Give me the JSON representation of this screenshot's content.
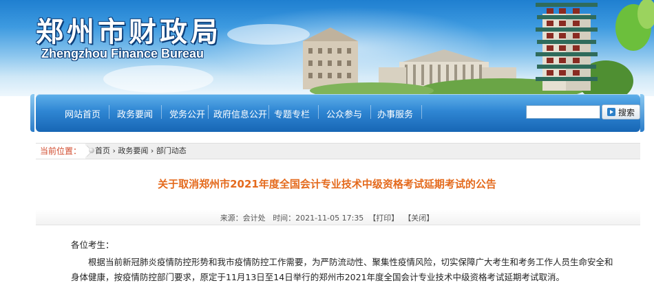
{
  "header": {
    "site_title": "郑州市财政局",
    "site_subtitle": "Zhengzhou Finance Bureau"
  },
  "nav": {
    "items": [
      "网站首页",
      "政务要闻",
      "党务公开",
      "政府信息公开",
      "专题专栏",
      "公众参与",
      "办事服务"
    ],
    "search_value": "",
    "search_button": "搜索"
  },
  "breadcrumb": {
    "label": "当前位置：",
    "items": [
      "首页",
      "政务要闻",
      "部门动态"
    ],
    "separator": " › "
  },
  "article": {
    "title": "关于取消郑州市2021年度全国会计专业技术中级资格考试延期考试的公告",
    "meta": {
      "source": "来源：会计处",
      "time": "时间：2021-11-05 17:35",
      "print": "【打印】",
      "close": "【关闭】"
    },
    "salutation": "各位考生：",
    "paragraph_line1": "根据当前新冠肺炎疫情防控形势和我市疫情防控工作需要，为严防流动性、聚集性疫情风险，切实保障广大考生和考务工作人员生命安全和",
    "paragraph_line2": "身体健康，按疫情防控部门要求，原定于11月13日至14日举行的郑州市2021年度全国会计专业技术中级资格考试延期考试取消。"
  },
  "colors": {
    "nav_blue": "#2f86d3",
    "title_orange": "#e46a1d",
    "crumb_label_red": "#d04a2c"
  }
}
